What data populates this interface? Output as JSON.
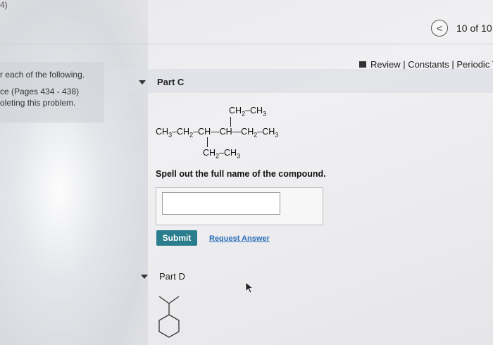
{
  "corner_text": "4)",
  "nav": {
    "back_icon": "chevron-left-icon",
    "back_glyph": "<",
    "count": "10 of 10"
  },
  "review": {
    "icon": "square-icon",
    "text": "Review | Constants | Periodic Ta"
  },
  "left_panel": {
    "line1": "r each of the following.",
    "line2": "ce (Pages 434 - 438)",
    "line3": "oleting this problem."
  },
  "part_c": {
    "label": "Part C",
    "prompt": "Spell out the full name of the compound.",
    "input_value": "",
    "submit_label": "Submit",
    "request_label": "Request Answer"
  },
  "part_d": {
    "label": "Part D"
  },
  "colors": {
    "submit": "#2a7d8c",
    "link": "#2a6fb8"
  }
}
